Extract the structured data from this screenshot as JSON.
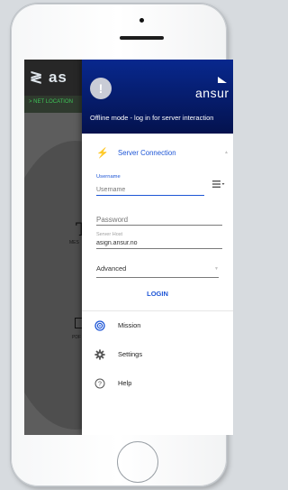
{
  "background_app": {
    "logo": "≷ as",
    "location_banner": "> NET LOCATION",
    "big_letter": "T",
    "center_label": "MES",
    "doc_label": "PDF"
  },
  "drawer": {
    "avatar_glyph": "!",
    "brand": "ansur",
    "offline_message": "Offline mode - log in for server interaction",
    "server_connection": {
      "label": "Server Connection",
      "username_label": "Username",
      "username_placeholder": "Username",
      "password_placeholder": "Password",
      "server_host_label": "Server Host",
      "server_host_value": "asign.ansur.no",
      "advanced_label": "Advanced",
      "login_label": "LOGIN"
    },
    "menu": [
      {
        "label": "Mission",
        "icon": "mission-target-icon"
      },
      {
        "label": "Settings",
        "icon": "gear-icon"
      },
      {
        "label": "Help",
        "icon": "help-circle-icon"
      }
    ]
  },
  "colors": {
    "accent": "#1e56d6",
    "header_top": "#08288e",
    "header_bottom": "#04124e",
    "location_text": "#3ec457"
  }
}
